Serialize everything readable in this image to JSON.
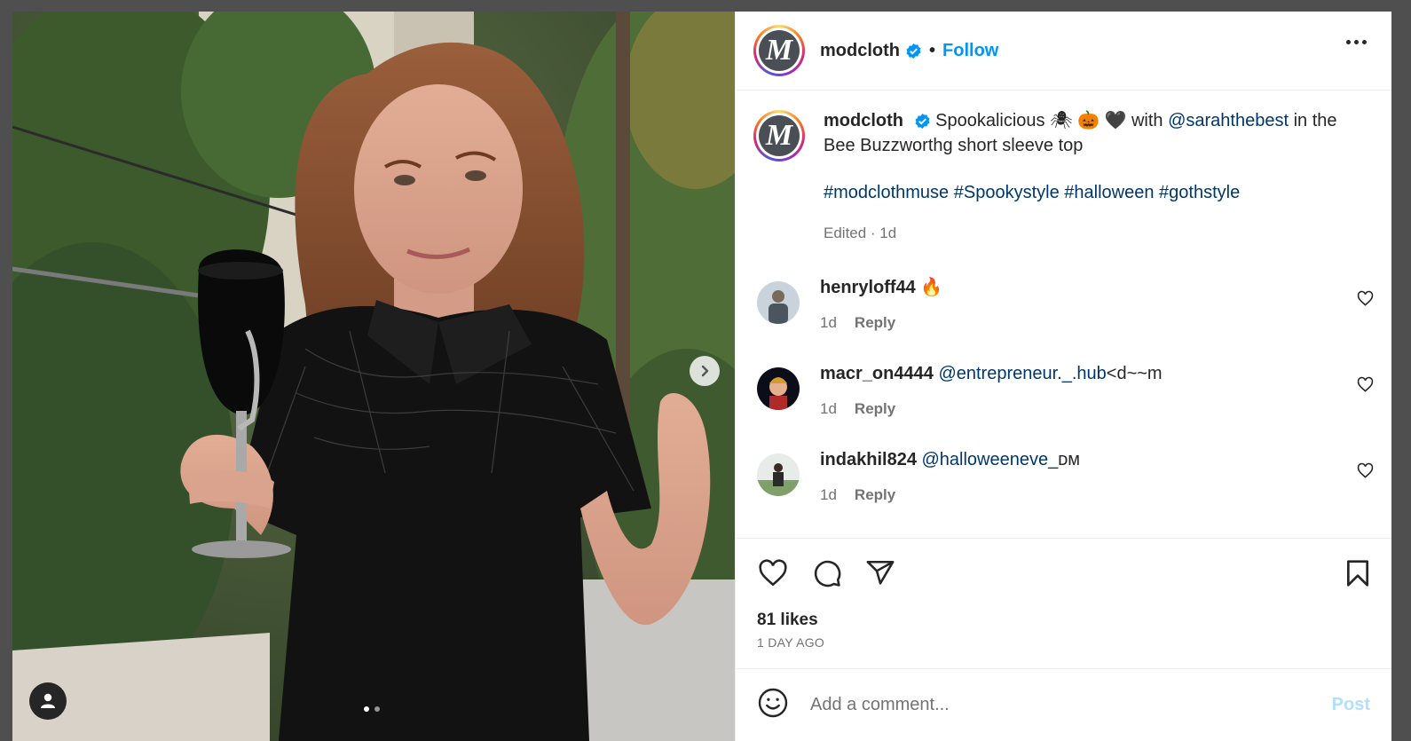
{
  "post": {
    "author": "modcloth",
    "follow_label": "Follow",
    "separator": "•",
    "caption_text_1": "Spookalicious 🕷 🎃 🖤 with",
    "caption_mention": "@sarahthebest",
    "caption_text_2": "in the Bee Buzzworthg short sleeve top",
    "hashtags": [
      "#modclothmuse",
      "#Spookystyle",
      "#halloween",
      "#gothstyle"
    ],
    "edited_meta": "Edited · 1d",
    "likes": "81 likes",
    "date": "1 DAY AGO",
    "avatar_letter": "M"
  },
  "comments": [
    {
      "user": "henryloff44",
      "text": "🔥",
      "mention": "",
      "time": "1d",
      "reply": "Reply"
    },
    {
      "user": "macr_on4444",
      "text": "<d~~m",
      "mention": "@entrepreneur._.hub",
      "time": "1d",
      "reply": "Reply"
    },
    {
      "user": "indakhil824",
      "text": "ᴅᴍ",
      "mention": "@halloweeneve_",
      "time": "1d",
      "reply": "Reply"
    }
  ],
  "comment_box": {
    "placeholder": "Add a comment...",
    "post_label": "Post"
  },
  "colors": {
    "link_blue": "#0095f6",
    "mention": "#00376b",
    "muted": "#737373",
    "verified": "#0095f6"
  },
  "icons": [
    "verified-badge-icon",
    "more-options-icon",
    "heart-icon",
    "comment-icon",
    "share-icon",
    "bookmark-icon",
    "emoji-icon",
    "chevron-right-icon",
    "user-tag-icon"
  ]
}
